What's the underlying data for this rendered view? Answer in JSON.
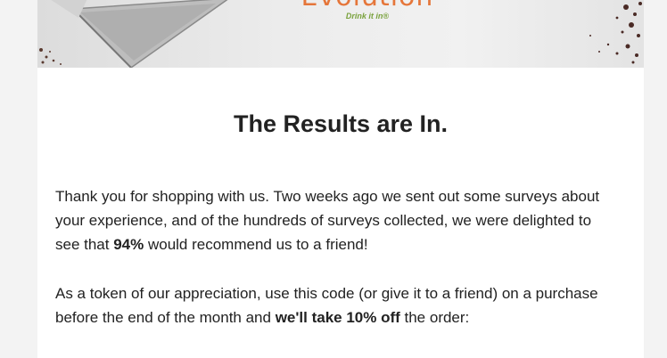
{
  "hero": {
    "brand_name": "Evolution",
    "tagline": "Drink it in®"
  },
  "headline": "The Results are In.",
  "paragraph1": {
    "text_before": "Thank you for shopping with us. Two weeks ago we sent out some surveys about your experience, and of the hundreds of surveys collected, we were delighted to see that ",
    "highlight": "94%",
    "text_after": " would recommend us to a friend!"
  },
  "paragraph2": {
    "text_before": "As a token of our appreciation, use this code (or give it to a friend) on a purchase before the end of the month and ",
    "highlight": "we'll take 10% off",
    "text_after": " the order:"
  },
  "colors": {
    "brand_orange": "#e5763a",
    "tagline_green": "#7aa23d",
    "text": "#222222"
  }
}
